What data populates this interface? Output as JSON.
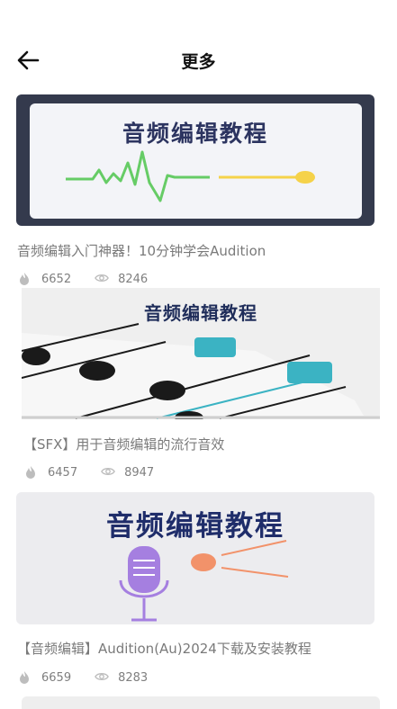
{
  "header": {
    "title": "更多",
    "back_icon": "arrow-left-icon"
  },
  "items": [
    {
      "banner_text": "音频编辑教程",
      "caption": "音频编辑入门神器！10分钟学会Audition",
      "likes": "6652",
      "views": "8246",
      "theme": {
        "bg": "#343a4d",
        "panel": "#f3f4f8",
        "text": "#2c3460",
        "wave": "#66cc66",
        "line": "#f5d24a"
      }
    },
    {
      "banner_text": "音频编辑教程",
      "caption": "【SFX】用于音频编辑的流行音效",
      "likes": "6457",
      "views": "8947",
      "theme": {
        "bg": "#efefef",
        "text": "#1f2d5a",
        "knob": "#1a1a1a",
        "slider": "#3bb3c3"
      }
    },
    {
      "banner_text": "音频编辑教程",
      "caption": "【音频编辑】Audition(Au)2024下载及安装教程",
      "likes": "6659",
      "views": "8283",
      "theme": {
        "bg": "#ececef",
        "text": "#1f2d6a",
        "mic": "#a57fe0",
        "dot": "#f2926a"
      }
    }
  ],
  "stat_icons": {
    "likes": "flame-icon",
    "views": "eye-icon"
  }
}
